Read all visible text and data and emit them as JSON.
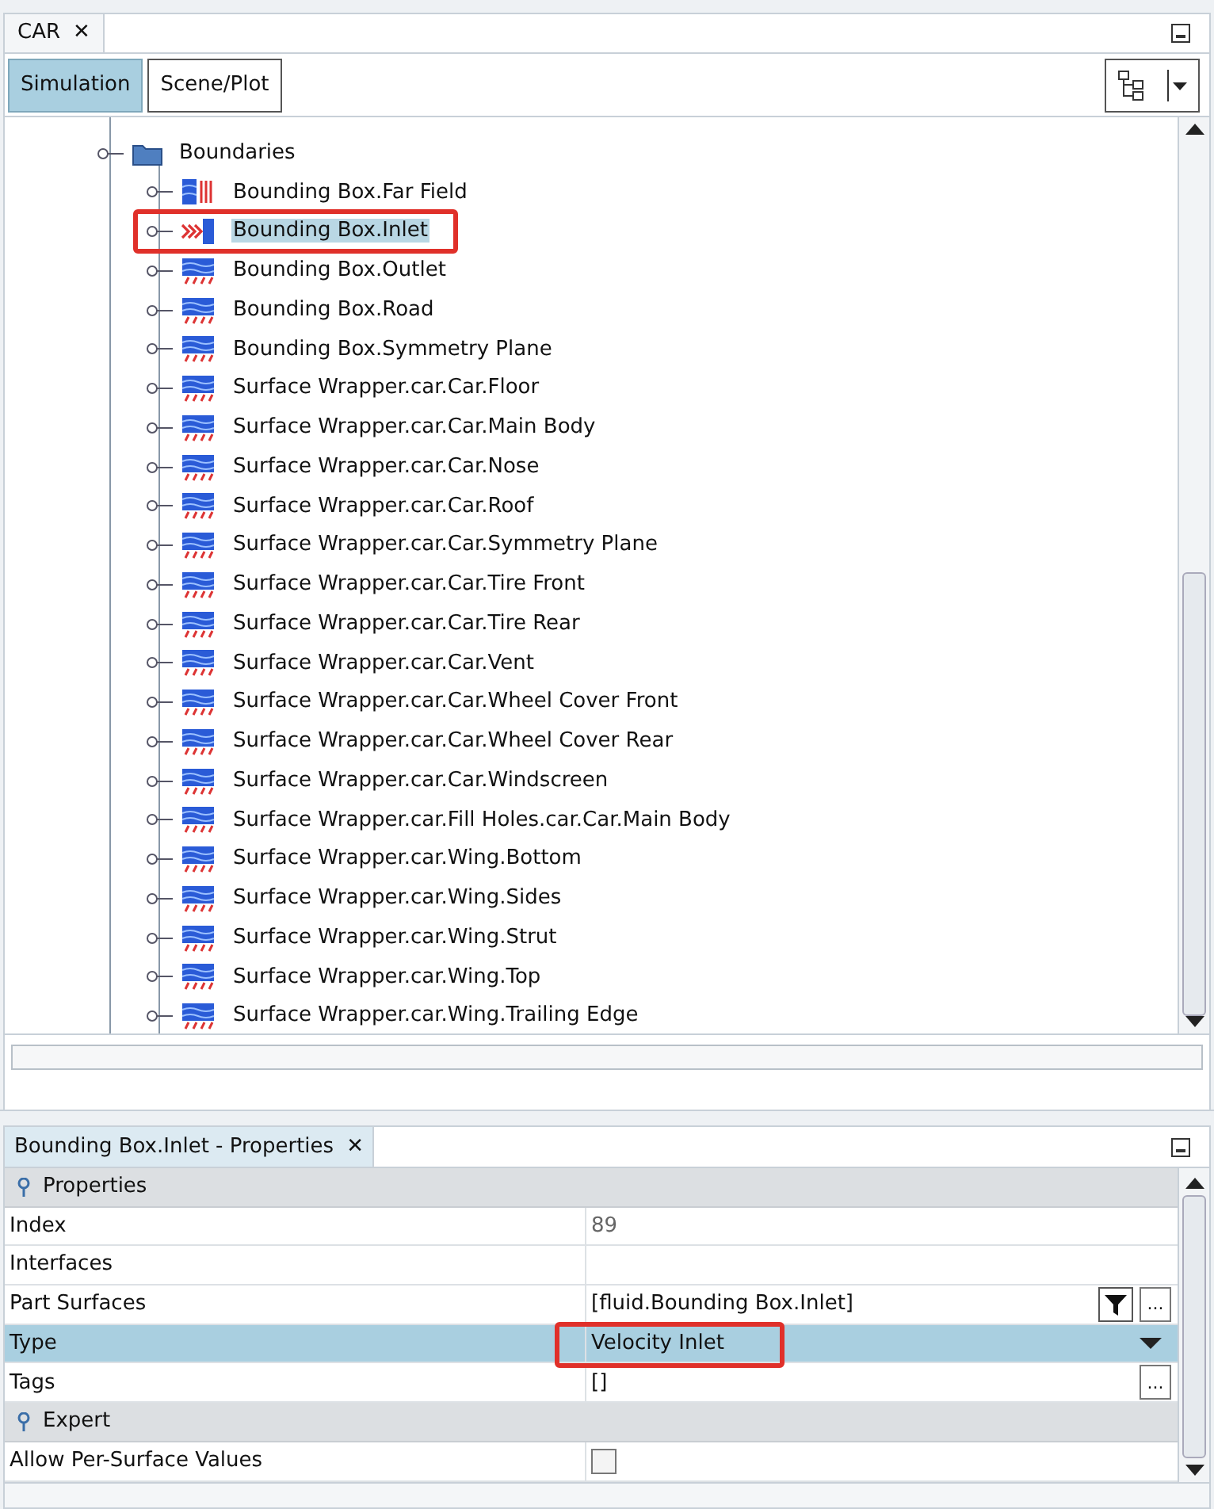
{
  "top_tab": {
    "title": "CAR",
    "close": "✕"
  },
  "view_tabs": [
    {
      "label": "Simulation",
      "selected": true
    },
    {
      "label": "Scene/Plot",
      "selected": false
    }
  ],
  "tree": {
    "folder": "Boundaries",
    "items": [
      {
        "label": "Bounding Box.Far Field",
        "kind": "farfield",
        "selected": false,
        "annotated": false
      },
      {
        "label": "Bounding Box.Inlet",
        "kind": "inlet",
        "selected": true,
        "annotated": true
      },
      {
        "label": "Bounding Box.Outlet",
        "kind": "wall",
        "selected": false,
        "annotated": false
      },
      {
        "label": "Bounding Box.Road",
        "kind": "wall",
        "selected": false,
        "annotated": false
      },
      {
        "label": "Bounding Box.Symmetry Plane",
        "kind": "wall",
        "selected": false,
        "annotated": false
      },
      {
        "label": "Surface Wrapper.car.Car.Floor",
        "kind": "wall",
        "selected": false,
        "annotated": false
      },
      {
        "label": "Surface Wrapper.car.Car.Main Body",
        "kind": "wall",
        "selected": false,
        "annotated": false
      },
      {
        "label": "Surface Wrapper.car.Car.Nose",
        "kind": "wall",
        "selected": false,
        "annotated": false
      },
      {
        "label": "Surface Wrapper.car.Car.Roof",
        "kind": "wall",
        "selected": false,
        "annotated": false
      },
      {
        "label": "Surface Wrapper.car.Car.Symmetry Plane",
        "kind": "wall",
        "selected": false,
        "annotated": false
      },
      {
        "label": "Surface Wrapper.car.Car.Tire Front",
        "kind": "wall",
        "selected": false,
        "annotated": false
      },
      {
        "label": "Surface Wrapper.car.Car.Tire Rear",
        "kind": "wall",
        "selected": false,
        "annotated": false
      },
      {
        "label": "Surface Wrapper.car.Car.Vent",
        "kind": "wall",
        "selected": false,
        "annotated": false
      },
      {
        "label": "Surface Wrapper.car.Car.Wheel Cover Front",
        "kind": "wall",
        "selected": false,
        "annotated": false
      },
      {
        "label": "Surface Wrapper.car.Car.Wheel Cover Rear",
        "kind": "wall",
        "selected": false,
        "annotated": false
      },
      {
        "label": "Surface Wrapper.car.Car.Windscreen",
        "kind": "wall",
        "selected": false,
        "annotated": false
      },
      {
        "label": "Surface Wrapper.car.Fill Holes.car.Car.Main Body",
        "kind": "wall",
        "selected": false,
        "annotated": false
      },
      {
        "label": "Surface Wrapper.car.Wing.Bottom",
        "kind": "wall",
        "selected": false,
        "annotated": false
      },
      {
        "label": "Surface Wrapper.car.Wing.Sides",
        "kind": "wall",
        "selected": false,
        "annotated": false
      },
      {
        "label": "Surface Wrapper.car.Wing.Strut",
        "kind": "wall",
        "selected": false,
        "annotated": false
      },
      {
        "label": "Surface Wrapper.car.Wing.Top",
        "kind": "wall",
        "selected": false,
        "annotated": false
      },
      {
        "label": "Surface Wrapper.car.Wing.Trailing Edge",
        "kind": "wall",
        "selected": false,
        "annotated": false
      }
    ]
  },
  "properties": {
    "title": "Bounding Box.Inlet - Properties",
    "close": "✕",
    "rows": [
      {
        "kind": "group",
        "label": "Properties"
      },
      {
        "kind": "text",
        "label": "Index",
        "value": "89",
        "selected": false,
        "annotated": false
      },
      {
        "kind": "text",
        "label": "Interfaces",
        "selected": false,
        "annotated": false
      },
      {
        "kind": "filter",
        "label": "Part Surfaces",
        "value": "[fluid.Bounding Box.Inlet]",
        "button": "...",
        "selected": false,
        "annotated": false
      },
      {
        "kind": "dropdown",
        "label": "Type",
        "value": "Velocity Inlet",
        "selected": true,
        "annotated": true
      },
      {
        "kind": "ellipsis",
        "label": "Tags",
        "value": "[]",
        "button": "...",
        "selected": false,
        "annotated": false
      },
      {
        "kind": "group",
        "label": "Expert"
      },
      {
        "kind": "checkbox",
        "label": "Allow Per-Surface Values",
        "checked": false,
        "selected": false,
        "annotated": false
      }
    ]
  }
}
